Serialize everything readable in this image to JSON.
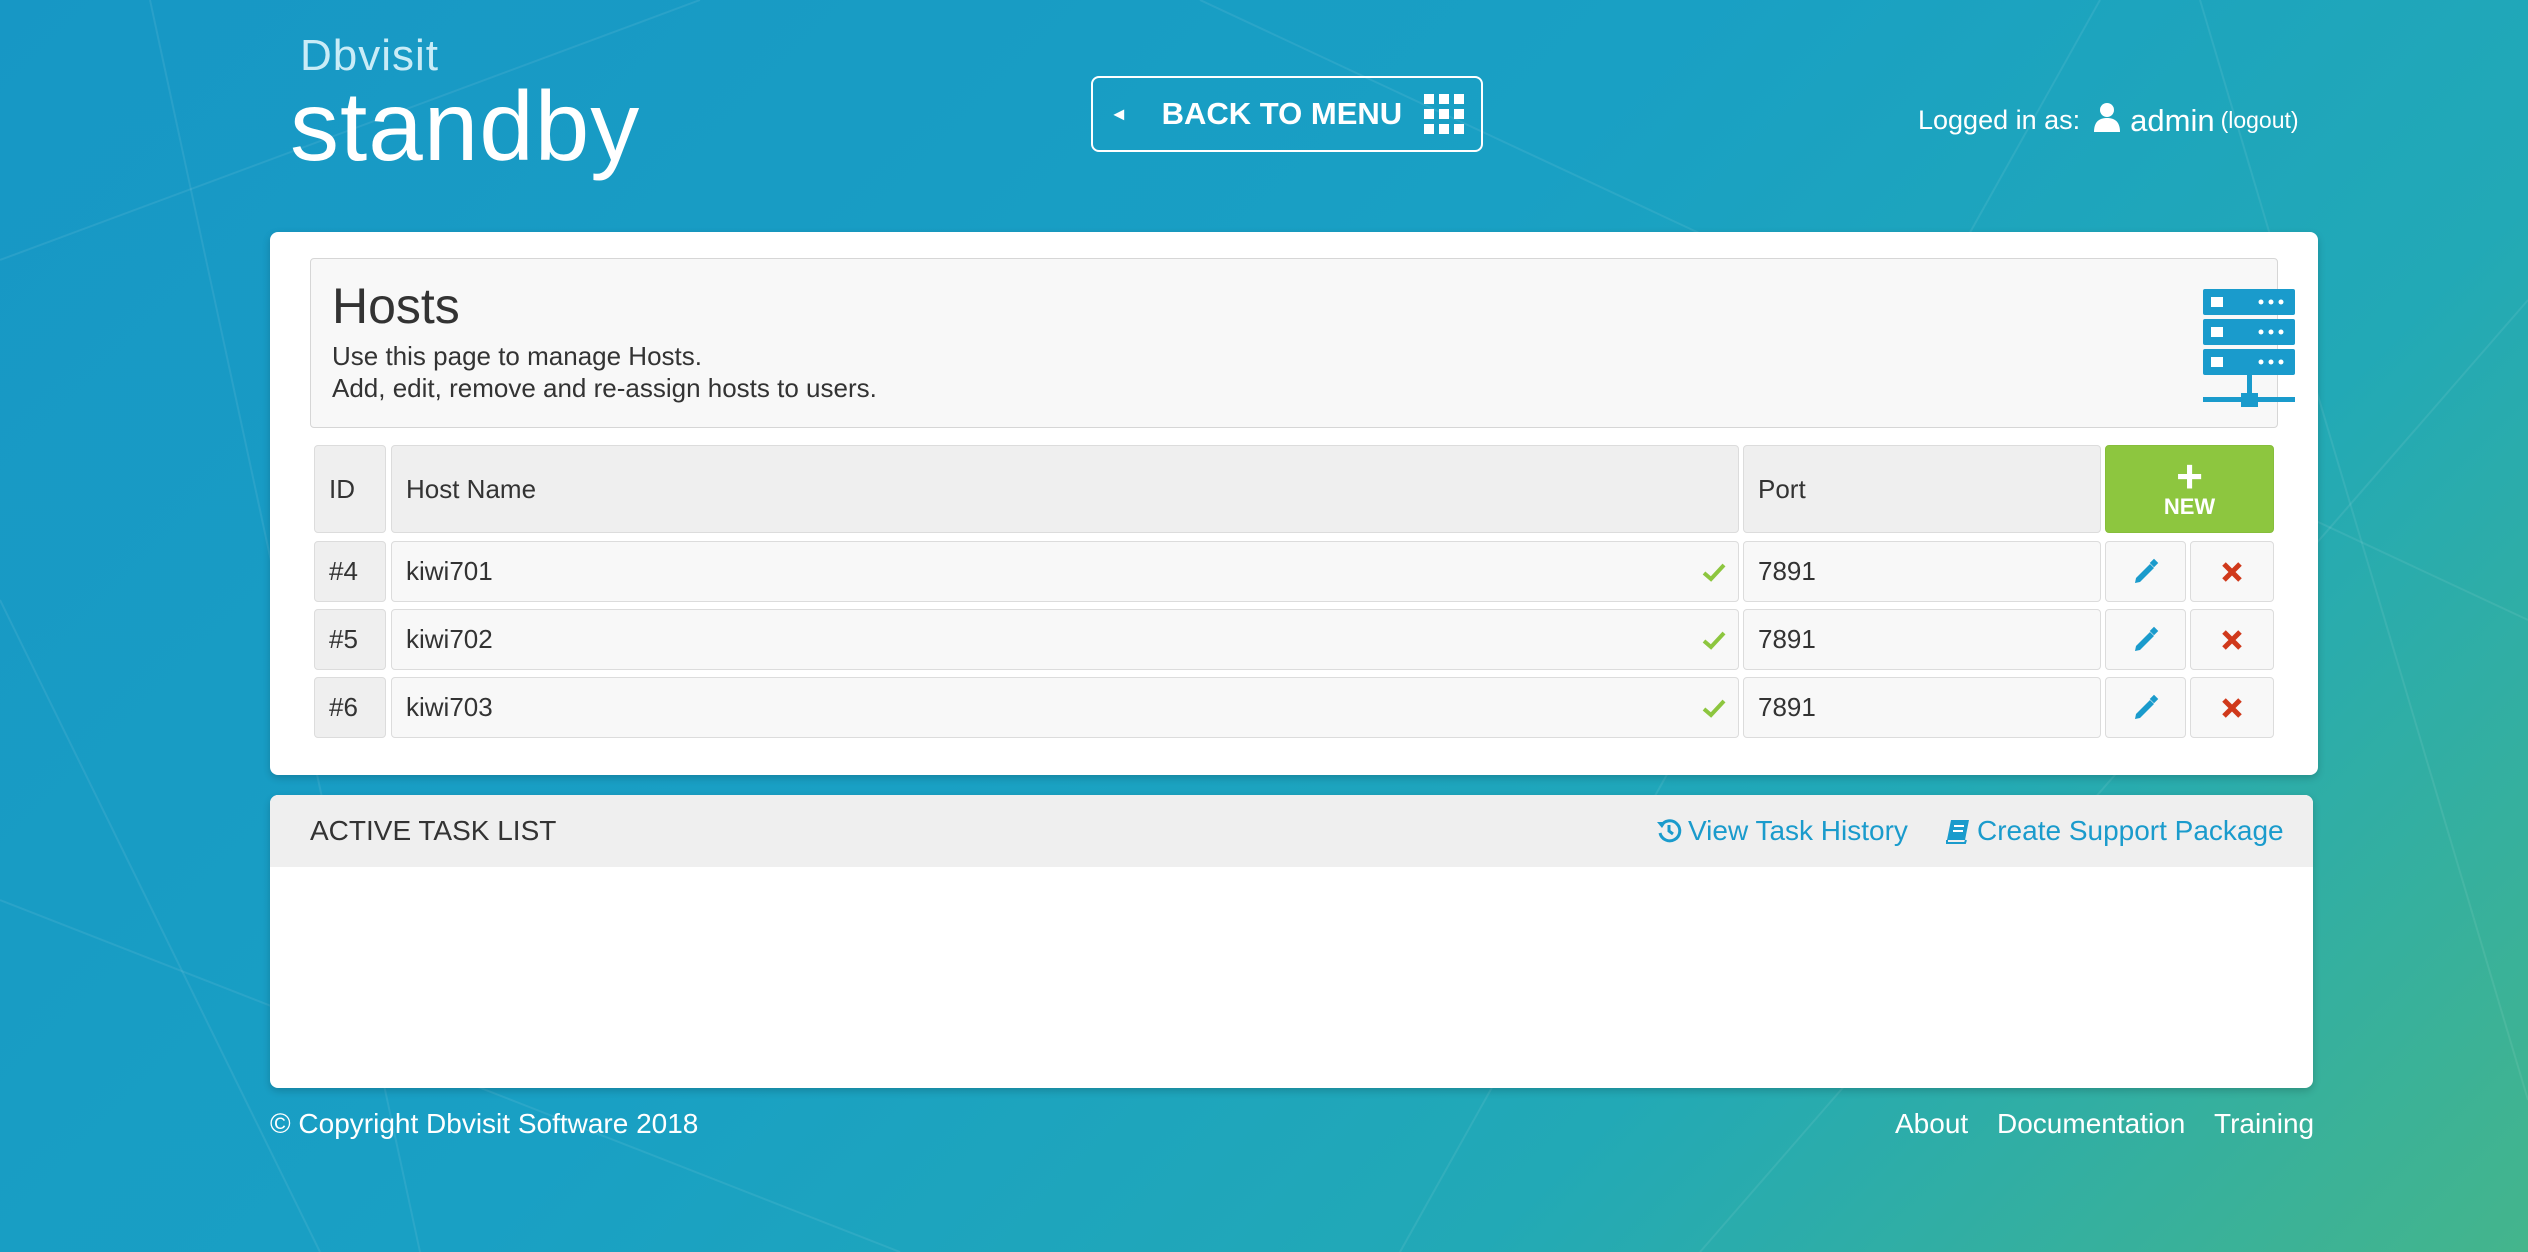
{
  "brand": {
    "small": "Dbvisit",
    "big": "standby"
  },
  "header": {
    "back_label": "BACK TO MENU",
    "logged_in_label": "Logged in as:",
    "username": "admin",
    "logout_label": "(logout)"
  },
  "hosts_page": {
    "title": "Hosts",
    "desc_line1": "Use this page to manage Hosts.",
    "desc_line2": "Add, edit, remove and re-assign hosts to users.",
    "columns": {
      "id": "ID",
      "host_name": "Host Name",
      "port": "Port"
    },
    "new_label": "NEW",
    "rows": [
      {
        "id": "#4",
        "host_name": "kiwi701",
        "port": "7891"
      },
      {
        "id": "#5",
        "host_name": "kiwi702",
        "port": "7891"
      },
      {
        "id": "#6",
        "host_name": "kiwi703",
        "port": "7891"
      }
    ]
  },
  "task_list": {
    "title": "ACTIVE TASK LIST",
    "view_history": "View Task History",
    "support_package": "Create Support Package"
  },
  "footer": {
    "copyright": "© Copyright Dbvisit Software 2018",
    "links": [
      "About",
      "Documentation",
      "Training"
    ]
  },
  "colors": {
    "accent": "#1a9bcc",
    "new_button": "#8dc63f",
    "delete": "#d0391b",
    "check": "#8dc63f"
  }
}
